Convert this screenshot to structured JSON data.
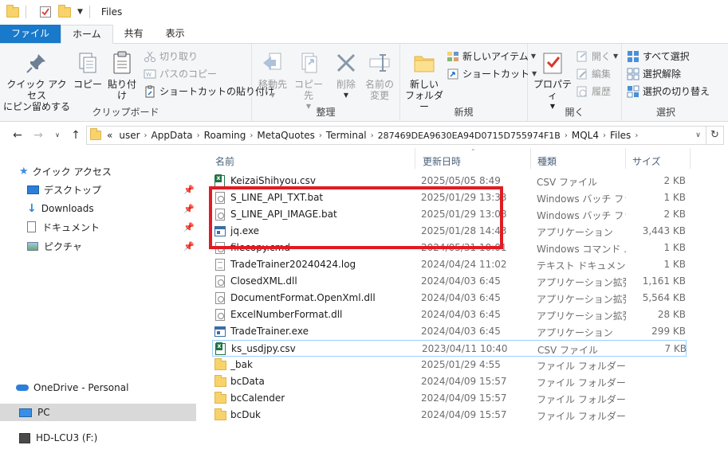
{
  "window": {
    "title": "Files"
  },
  "tabs": [
    {
      "label": "ファイル"
    },
    {
      "label": "ホーム"
    },
    {
      "label": "共有"
    },
    {
      "label": "表示"
    }
  ],
  "ribbon": {
    "clipboard": {
      "label": "クリップボード",
      "pin_quick": "クイック アクセス\nにピン留めする",
      "copy": "コピー",
      "paste": "貼り付け",
      "cut": "切り取り",
      "copy_path": "パスのコピー",
      "paste_shortcut": "ショートカットの貼り付け"
    },
    "organize": {
      "label": "整理",
      "move_to": "移動先",
      "copy_to": "コピー先",
      "delete": "削除",
      "rename": "名前の\n変更"
    },
    "new": {
      "label": "新規",
      "new_folder": "新しい\nフォルダー",
      "new_item": "新しいアイテム",
      "shortcut": "ショートカット"
    },
    "open": {
      "label": "開く",
      "properties": "プロパティ",
      "open": "開く",
      "edit": "編集",
      "history": "履歴"
    },
    "select": {
      "label": "選択",
      "select_all": "すべて選択",
      "select_none": "選択解除",
      "invert": "選択の切り替え"
    }
  },
  "address": {
    "prefix": "«",
    "crumbs": [
      "user",
      "AppData",
      "Roaming",
      "MetaQuotes",
      "Terminal",
      "287469DEA9630EA94D0715D755974F1B",
      "MQL4",
      "Files"
    ]
  },
  "navpane": {
    "items": [
      {
        "label": "クイック アクセス",
        "icon": "star-icon"
      },
      {
        "label": "デスクトップ",
        "icon": "desktop-icon",
        "pinned": true
      },
      {
        "label": "Downloads",
        "icon": "download-icon",
        "pinned": true
      },
      {
        "label": "ドキュメント",
        "icon": "document-icon",
        "pinned": true
      },
      {
        "label": "ピクチャ",
        "icon": "pictures-icon",
        "pinned": true
      },
      {
        "label": "OneDrive - Personal",
        "icon": "cloud-icon"
      },
      {
        "label": "PC",
        "icon": "pc-icon",
        "selected": true
      },
      {
        "label": "HD-LCU3 (F:)",
        "icon": "drive-icon"
      }
    ]
  },
  "columns": {
    "name": "名前",
    "date": "更新日時",
    "type": "種類",
    "size": "サイズ"
  },
  "files": [
    {
      "name": "KeizaiShihyou.csv",
      "date": "2025/05/05 8:49",
      "type": "CSV ファイル",
      "size": "2 KB",
      "icon": "csv"
    },
    {
      "name": "S_LINE_API_TXT.bat",
      "date": "2025/01/29 13:33",
      "type": "Windows バッチ ファ...",
      "size": "1 KB",
      "icon": "bat"
    },
    {
      "name": "S_LINE_API_IMAGE.bat",
      "date": "2025/01/29 13:08",
      "type": "Windows バッチ ファ...",
      "size": "2 KB",
      "icon": "bat"
    },
    {
      "name": "jq.exe",
      "date": "2025/01/28 14:43",
      "type": "アプリケーション",
      "size": "3,443 KB",
      "icon": "exe"
    },
    {
      "name": "filecopy.cmd",
      "date": "2024/05/31 10:01",
      "type": "Windows コマンド ...",
      "size": "1 KB",
      "icon": "bat"
    },
    {
      "name": "TradeTrainer20240424.log",
      "date": "2024/04/24 11:02",
      "type": "テキスト ドキュメント",
      "size": "1 KB",
      "icon": "txt"
    },
    {
      "name": "ClosedXML.dll",
      "date": "2024/04/03 6:45",
      "type": "アプリケーション拡張",
      "size": "1,161 KB",
      "icon": "dll"
    },
    {
      "name": "DocumentFormat.OpenXml.dll",
      "date": "2024/04/03 6:45",
      "type": "アプリケーション拡張",
      "size": "5,564 KB",
      "icon": "dll"
    },
    {
      "name": "ExcelNumberFormat.dll",
      "date": "2024/04/03 6:45",
      "type": "アプリケーション拡張",
      "size": "28 KB",
      "icon": "dll"
    },
    {
      "name": "TradeTrainer.exe",
      "date": "2024/04/03 6:45",
      "type": "アプリケーション",
      "size": "299 KB",
      "icon": "exe"
    },
    {
      "name": "ks_usdjpy.csv",
      "date": "2023/04/11 10:40",
      "type": "CSV ファイル",
      "size": "7 KB",
      "icon": "csv",
      "focused": true
    },
    {
      "name": "_bak",
      "date": "2025/01/29 4:55",
      "type": "ファイル フォルダー",
      "size": "",
      "icon": "folder"
    },
    {
      "name": "bcData",
      "date": "2024/04/09 15:57",
      "type": "ファイル フォルダー",
      "size": "",
      "icon": "folder"
    },
    {
      "name": "bcCalender",
      "date": "2024/04/09 15:57",
      "type": "ファイル フォルダー",
      "size": "",
      "icon": "folder"
    },
    {
      "name": "bcDuk",
      "date": "2024/04/09 15:57",
      "type": "ファイル フォルダー",
      "size": "",
      "icon": "folder"
    }
  ],
  "colors": {
    "file_tab": "#1979ca",
    "highlight_box": "#e01b24",
    "selected_nav": "#d9d9d9"
  }
}
